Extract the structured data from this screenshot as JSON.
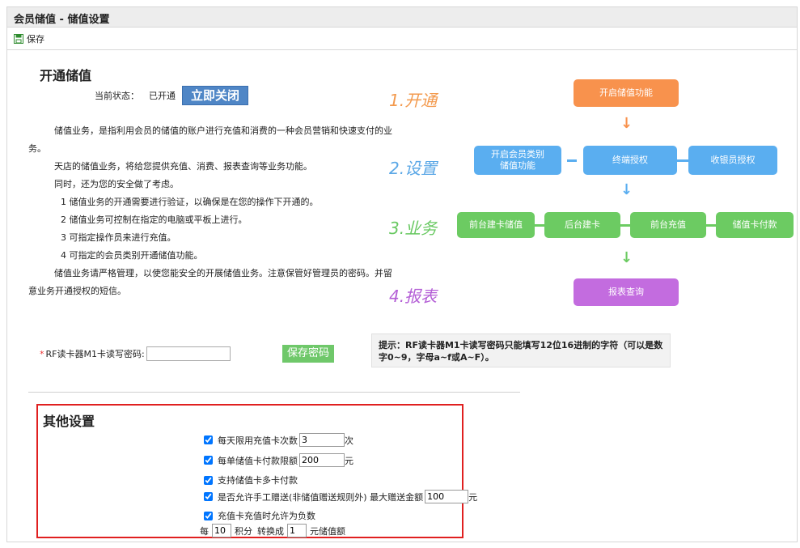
{
  "header": {
    "title": "会员储值 - 储值设置"
  },
  "toolbar": {
    "save_label": "保存"
  },
  "open_section": {
    "title": "开通储值",
    "status_label": "当前状态：",
    "status_value": "已开通",
    "close_button": "立即关闭"
  },
  "description": [
    "储值业务，是指利用会员的储值的账户进行充值和消费的一种会员营销和快速支付的业",
    "务。",
    "天店的储值业务，将给您提供充值、消费、报表查询等业务功能。",
    "同时，还为您的安全做了考虑。",
    "1   储值业务的开通需要进行验证，以确保是在您的操作下开通的。",
    "2   储值业务可控制在指定的电脑或平板上进行。",
    "3   可指定操作员来进行充值。",
    "4   可指定的会员类别开通储值功能。",
    "储值业务请严格管理，以使您能安全的开展储值业务。注意保管好管理员的密码。并留",
    "意业务开通授权的短信。"
  ],
  "rf": {
    "required_mark": "*",
    "label": "RF读卡器M1卡读写密码:",
    "value": "",
    "save_button": "保存密码"
  },
  "tip": {
    "text": "提示：RF读卡器M1卡读写密码只能填写12位16进制的字符（可以是数字0~9，字母a~f或A~F）。"
  },
  "flow": {
    "steps": [
      {
        "num": "1.",
        "label": "开通",
        "color": "#f39a4e"
      },
      {
        "num": "2.",
        "label": "设置",
        "color": "#5aa7e6"
      },
      {
        "num": "3.",
        "label": "业务",
        "color": "#67c860"
      },
      {
        "num": "4.",
        "label": "报表",
        "color": "#b45fd6"
      }
    ],
    "open_node": "开启储值功能",
    "settings": [
      "开启会员类别\n储值功能",
      "终端授权",
      "收银员授权"
    ],
    "business": [
      "前台建卡储值",
      "后台建卡",
      "前台充值",
      "储值卡付款"
    ],
    "report_node": "报表查询",
    "colors": {
      "orange": "#f8924d",
      "blue": "#5aaef0",
      "green": "#6ccb62",
      "purple": "#c36cdf"
    }
  },
  "other": {
    "title": "其他设置",
    "daily_limit": {
      "label": "每天限用充值卡次数",
      "value": "3",
      "unit": "次",
      "checked": true
    },
    "pay_limit": {
      "label": "每单储值卡付款限额",
      "value": "200",
      "unit": "元",
      "checked": true
    },
    "multi_card": {
      "label": "支持储值卡多卡付款",
      "checked": true
    },
    "manual_gift": {
      "label": "是否允许手工赠送(非储值赠送规则外) 最大赠送金额",
      "value": "100",
      "unit": "元",
      "checked": true
    },
    "negative": {
      "label": "充值卡充值时允许为负数",
      "checked": true
    },
    "points": {
      "prefix": "每",
      "points_value": "10",
      "points_label": "积分",
      "convert_label": "转换成",
      "amount_value": "1",
      "amount_label": "元储值额"
    }
  }
}
